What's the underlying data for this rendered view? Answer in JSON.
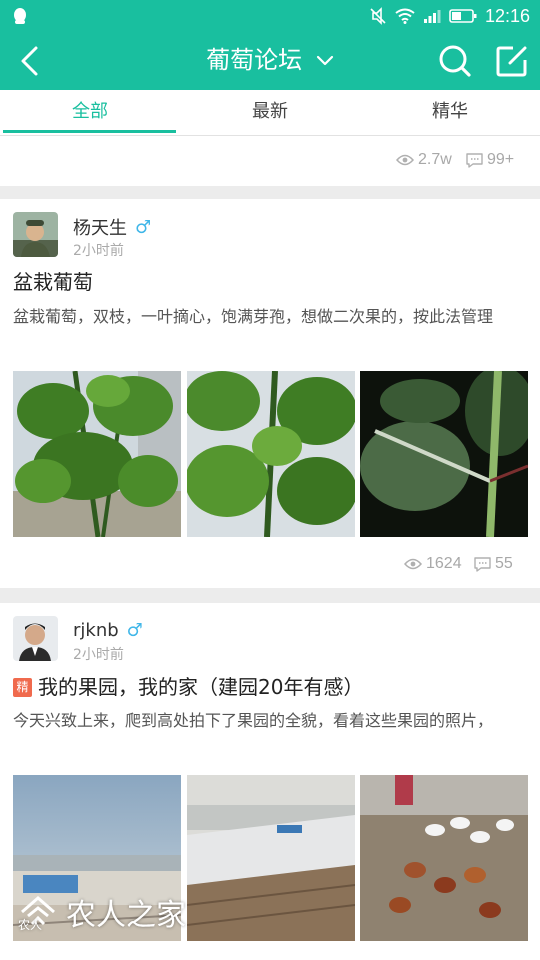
{
  "status_bar": {
    "time": "12:16"
  },
  "header": {
    "back_icon": "back-arrow-icon",
    "title": "葡萄论坛",
    "search_icon": "search-icon",
    "edit_icon": "edit-icon",
    "background": "#19bf9f"
  },
  "tabs": [
    {
      "label": "全部",
      "active": true
    },
    {
      "label": "最新",
      "active": false
    },
    {
      "label": "精华",
      "active": false
    }
  ],
  "summary_stats": {
    "views": "2.7w",
    "comments": "99+"
  },
  "posts": [
    {
      "author": "杨天生",
      "gender": "♂",
      "time": "2小时前",
      "featured": false,
      "title": "盆栽葡萄",
      "body": "盆栽葡萄，双枝，一叶摘心，饱满芽孢，想做二次果的，按此法管理",
      "views": "1624",
      "comments": "55"
    },
    {
      "author": "rjknb",
      "gender": "♂",
      "time": "2小时前",
      "featured": true,
      "badge": "精",
      "title": "我的果园，我的家（建园20年有感）",
      "body": "今天兴致上来，爬到高处拍下了果园的全貌，看着这些果园的照片，"
    }
  ],
  "watermark": {
    "text": "农人之家",
    "small": "农人"
  }
}
